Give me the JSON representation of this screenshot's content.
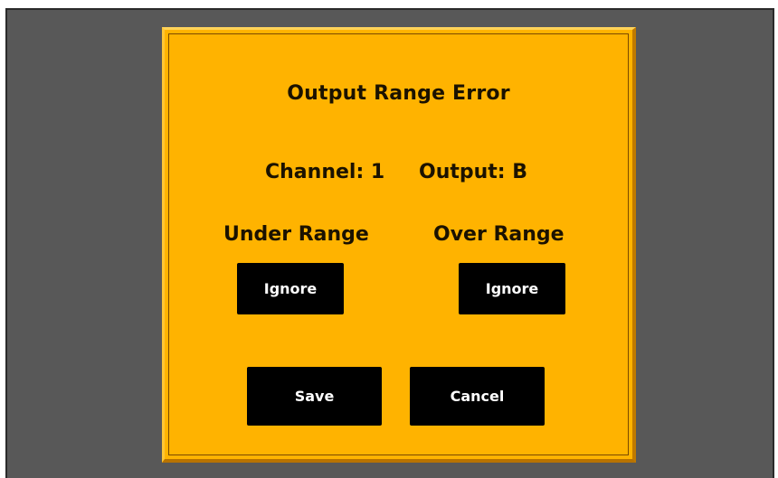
{
  "dialog": {
    "title": "Output Range Error",
    "channel_text": "Channel: 1",
    "output_text": "Output: B",
    "under_range_label": "Under Range",
    "over_range_label": "Over Range",
    "under_range_button": "Ignore",
    "over_range_button": "Ignore",
    "save_label": "Save",
    "cancel_label": "Cancel"
  },
  "colors": {
    "background": "#585858",
    "dialog": "#ffb300",
    "button": "#000000",
    "button_text": "#ffffff",
    "text": "#1b1200"
  }
}
